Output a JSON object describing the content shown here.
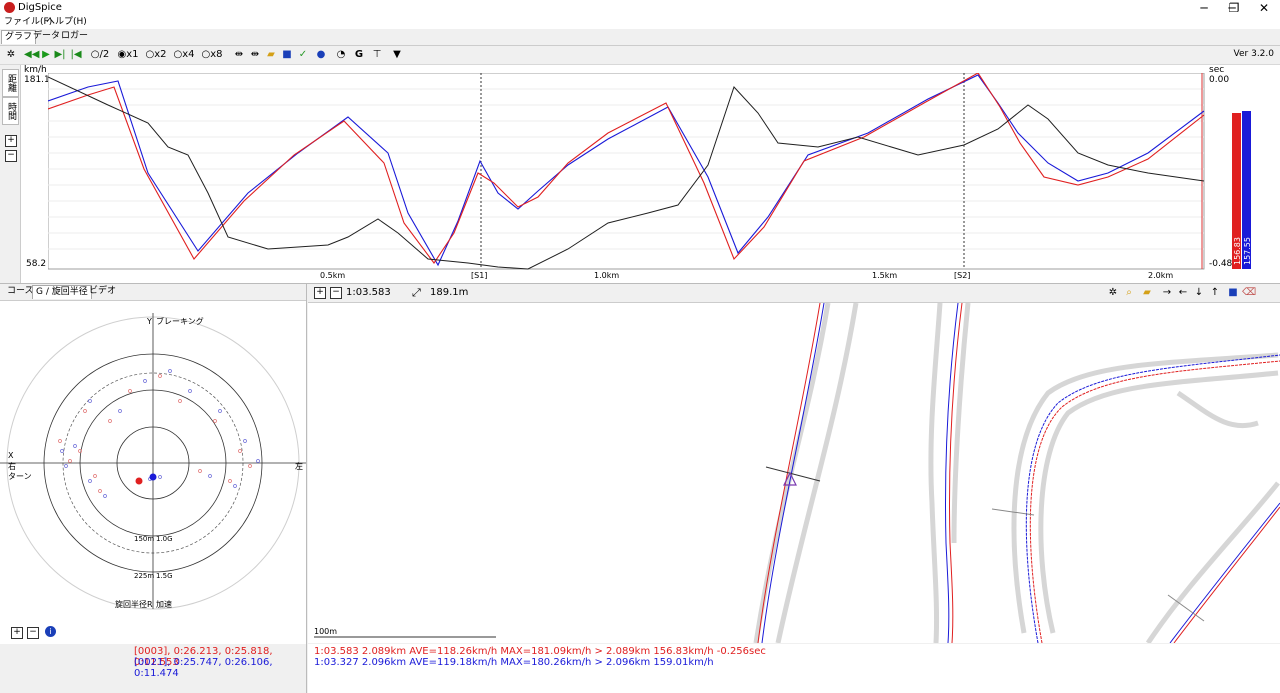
{
  "window": {
    "title": "DigSpice",
    "minimize": "─",
    "restore": "❐",
    "close": "✕"
  },
  "menu": {
    "file": "ファイル(F)",
    "help": "ヘルプ(H)"
  },
  "tabs": [
    "グラフ",
    "データ",
    "ロガー"
  ],
  "toolbar": {
    "speed_half": "/2",
    "speed_x1": "x1",
    "speed_x2": "x2",
    "speed_x4": "x4",
    "speed_x8": "x8",
    "version": "Ver 3.2.0"
  },
  "graph": {
    "side_tab_distance": "距離",
    "side_tab_time": "時間",
    "y_unit_left": "km/h",
    "y_unit_right": "sec",
    "y_max": "181.1",
    "y_min": "58.2",
    "y2_max": "0.00",
    "y2_min": "-0.48",
    "x_ticks": [
      "0.5km",
      "[S1]",
      "1.0km",
      "1.5km",
      "[S2]",
      "2.0km"
    ],
    "bar_red_label": "156.83",
    "bar_blue_label": "157.55",
    "colors": {
      "red": "#e02020",
      "blue": "#1a1ad8",
      "black": "#202020"
    }
  },
  "left_tabs": [
    "コース",
    "G / 旋回半径",
    "ビデオ"
  ],
  "gcircle": {
    "y_label": "Y",
    "braking": "ブレーキング",
    "x_label": "X",
    "right_turn_1": "右",
    "right_turn_2": "ターン",
    "left_label": "左",
    "ring_150": "150m",
    "ring_10g": "1.0G",
    "ring_225": "225m",
    "ring_15g": "1.5G",
    "radius_label": "旋回半径R",
    "accel": "加速"
  },
  "map": {
    "lap_time": "1:03.583",
    "distance": "189.1m",
    "scale": "100m"
  },
  "status": {
    "left_red": "[0003], 0:26.213, 0:25.818, 0:11.553",
    "left_blue": "[0021], 0:25.747, 0:26.106, 0:11.474",
    "right_red": "1:03.583 2.089km AVE=118.26km/h MAX=181.09km/h > 2.089km 156.83km/h -0.256sec",
    "right_blue": "1:03.327 2.096km AVE=119.18km/h MAX=180.26km/h > 2.096km 159.01km/h"
  }
}
